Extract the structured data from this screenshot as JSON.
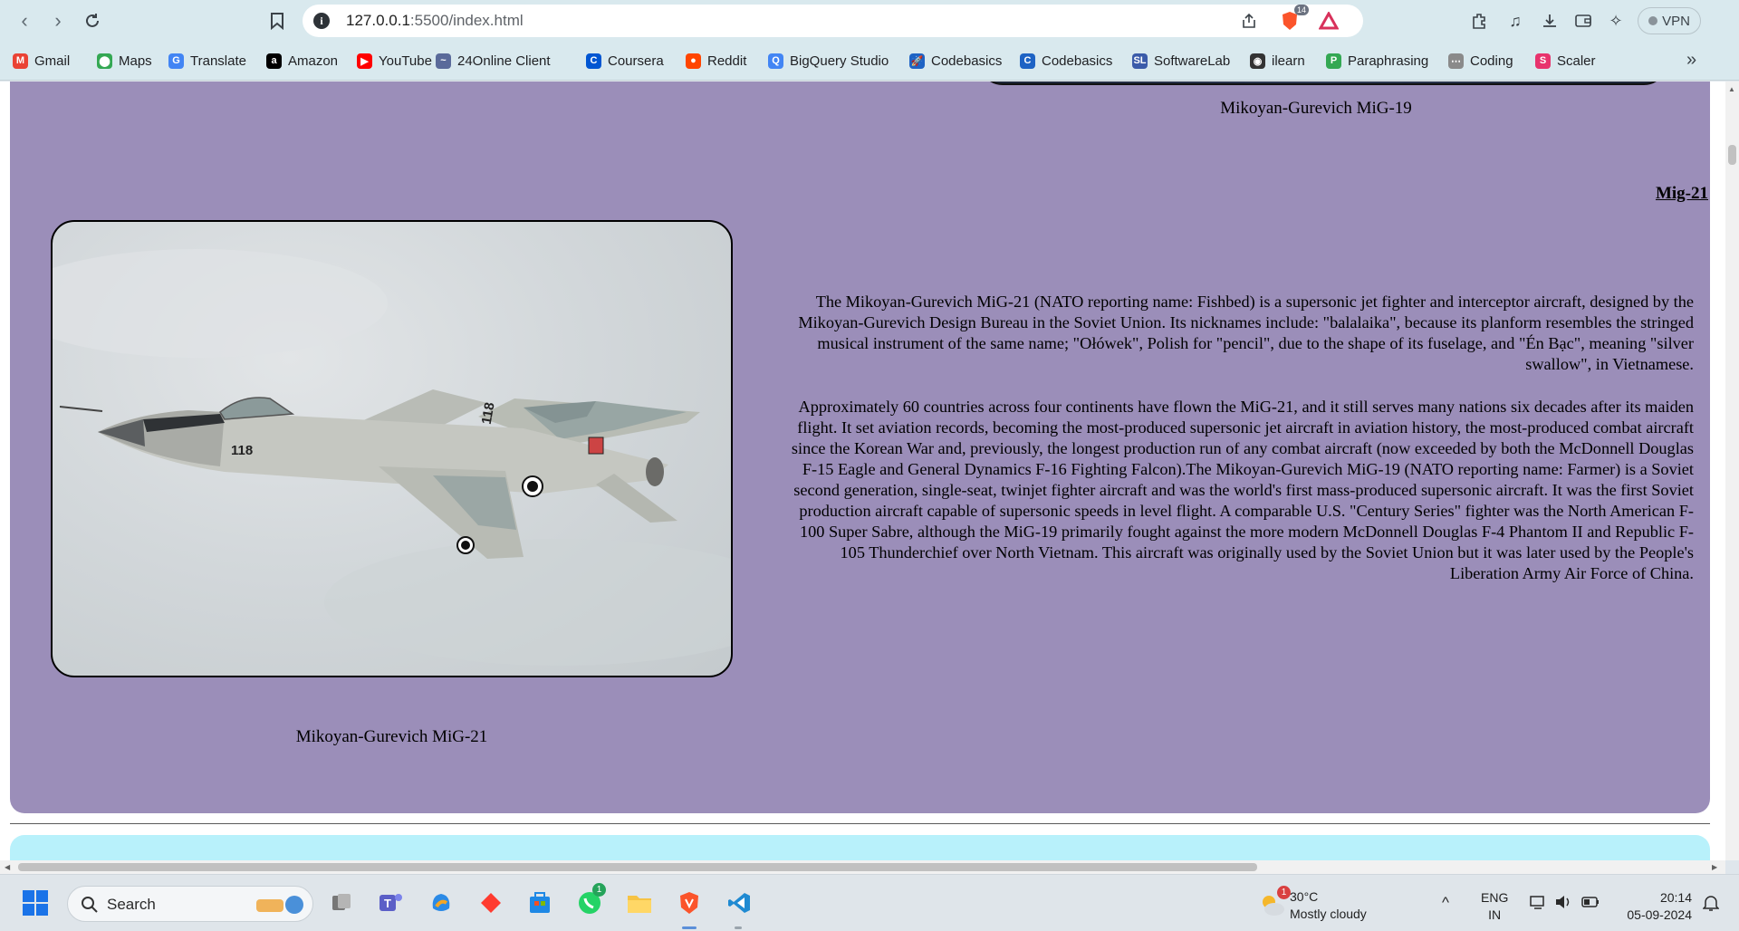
{
  "browser": {
    "url_host": "127.0.0.1",
    "url_path": ":5500/index.html",
    "brave_shield_count": "14",
    "vpn_label": "VPN",
    "bookmarks": [
      {
        "label": "Gmail",
        "icon": "gmail-icon",
        "color": "#ea4335",
        "glyph": "M"
      },
      {
        "label": "Maps",
        "icon": "maps-icon",
        "color": "#34a853",
        "glyph": "⬤"
      },
      {
        "label": "Translate",
        "icon": "translate-icon",
        "color": "#4285f4",
        "glyph": "G"
      },
      {
        "label": "Amazon",
        "icon": "amazon-icon",
        "color": "#000000",
        "glyph": "a"
      },
      {
        "label": "YouTube",
        "icon": "youtube-icon",
        "color": "#ff0000",
        "glyph": "▶"
      },
      {
        "label": "24Online Client",
        "icon": "24online-icon",
        "color": "#5a6a9a",
        "glyph": "~"
      },
      {
        "label": "Coursera",
        "icon": "coursera-icon",
        "color": "#0056d2",
        "glyph": "C"
      },
      {
        "label": "Reddit",
        "icon": "reddit-icon",
        "color": "#ff4500",
        "glyph": "●"
      },
      {
        "label": "BigQuery Studio",
        "icon": "bigquery-icon",
        "color": "#4285f4",
        "glyph": "Q"
      },
      {
        "label": "Codebasics",
        "icon": "rocket-icon",
        "color": "#1e63c4",
        "glyph": "🚀"
      },
      {
        "label": "Codebasics",
        "icon": "codebasics-icon",
        "color": "#1e63c4",
        "glyph": "C"
      },
      {
        "label": "SoftwareLab",
        "icon": "softwarelab-icon",
        "color": "#3b5ba9",
        "glyph": "SL"
      },
      {
        "label": "ilearn",
        "icon": "globe-icon",
        "color": "#333333",
        "glyph": "◉"
      },
      {
        "label": "Paraphrasing",
        "icon": "paraphrasing-icon",
        "color": "#34a853",
        "glyph": "P"
      },
      {
        "label": "Coding",
        "icon": "coding-icon",
        "color": "#8a8a8a",
        "glyph": "⋯"
      },
      {
        "label": "Scaler",
        "icon": "scaler-icon",
        "color": "#e8336d",
        "glyph": "S"
      }
    ]
  },
  "page": {
    "previous_caption": "Mikoyan-Gurevich MiG-19",
    "section_title": "Mig-21",
    "image_caption": "Mikoyan-Gurevich MiG-21",
    "jet_markings": "118",
    "paragraph1": "The Mikoyan-Gurevich MiG-21 (NATO reporting name: Fishbed) is a supersonic jet fighter and interceptor aircraft, designed by the Mikoyan-Gurevich Design Bureau in the Soviet Union. Its nicknames include: \"balalaika\", because its planform resembles the stringed musical instrument of the same name; \"Ołówek\", Polish for \"pencil\", due to the shape of its fuselage, and \"Én Bạc\", meaning \"silver swallow\", in Vietnamese.",
    "paragraph2": "Approximately 60 countries across four continents have flown the MiG-21, and it still serves many nations six decades after its maiden flight. It set aviation records, becoming the most-produced supersonic jet aircraft in aviation history, the most-produced combat aircraft since the Korean War and, previously, the longest production run of any combat aircraft (now exceeded by both the McDonnell Douglas F-15 Eagle and General Dynamics F-16 Fighting Falcon).The Mikoyan-Gurevich MiG-19 (NATO reporting name: Farmer) is a Soviet second generation, single-seat, twinjet fighter aircraft and was the world's first mass-produced supersonic aircraft. It was the first Soviet production aircraft capable of supersonic speeds in level flight. A comparable U.S. \"Century Series\" fighter was the North American F-100 Super Sabre, although the MiG-19 primarily fought against the more modern McDonnell Douglas F-4 Phantom II and Republic F-105 Thunderchief over North Vietnam. This aircraft was originally used by the Soviet Union but it was later used by the People's Liberation Army Air Force of China.",
    "card_color": "#9b8eb9",
    "next_card_color": "#b8f1fb"
  },
  "taskbar": {
    "search_label": "Search",
    "teams_badge": "",
    "whatsapp_badge": "1",
    "weather_badge": "1",
    "weather_temp": "30°C",
    "weather_desc": "Mostly cloudy",
    "lang_line1": "ENG",
    "lang_line2": "IN",
    "time": "20:14",
    "date": "05-09-2024"
  }
}
